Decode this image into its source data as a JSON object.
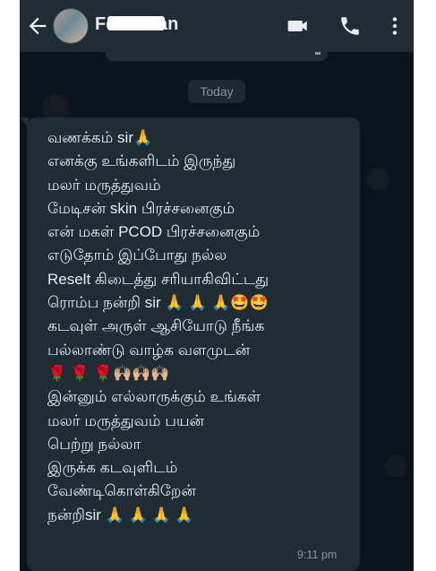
{
  "header": {
    "contact_name": "Fenasban",
    "back_icon": "arrow-left-icon",
    "avatar_icon": "contact-avatar",
    "video_icon": "video-camera-icon",
    "call_icon": "phone-icon",
    "menu_icon": "more-vertical-icon"
  },
  "chat": {
    "date_divider": "Today",
    "message": {
      "lines": [
        "வணக்கம் sir🙏",
        "எனக்கு உங்களிடம் இருந்து",
        "மலர் மருத்துவம்",
        "மேடிசன் skin பிரச்சனைகும்",
        "என் மகள் PCOD பிரச்சனைகும்",
        "எடுதோம் இப்போது நல்ல",
        "Reselt கிடைத்து சரியாகிவிட்டது",
        "ரொம்ப நன்றி sir 🙏 🙏 🙏🤩🤩",
        "கடவுள் அருள் ஆசியோடு நீங்க",
        "பல்லாண்டு வாழ்க வளமுடன்",
        "🌹 🌹 🌹🙌🏼🙌🏼🙌🏼",
        "இன்னும் எல்லாருக்கும் உங்கள்",
        "மலர் மருத்துவம் பயன்",
        "பெற்று நல்லா",
        "இருக்க கடவுளிடம்",
        "வேண்டிகொள்கிறேன்",
        "நன்றிsir 🙏 🙏 🙏 🙏"
      ],
      "time": "9:11 pm"
    }
  },
  "colors": {
    "background": "#0b141a",
    "header": "#1f2c34",
    "bubble": "#1f2c34",
    "text": "#e9edef",
    "meta_text": "#8696a0"
  }
}
